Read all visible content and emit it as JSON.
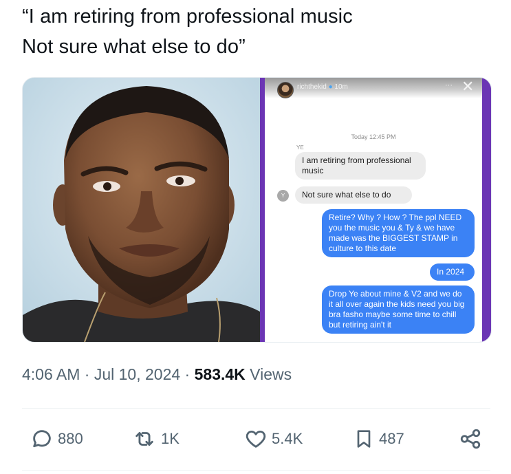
{
  "tweet": {
    "line1": "“I am retiring from professional music",
    "line2": "Not sure what else to do”"
  },
  "story": {
    "username": "richthekid",
    "age": "10m",
    "menu": "···",
    "close": "✕",
    "time": "Today 12:45 PM",
    "sender": "YE",
    "avatar_initial": "Y",
    "messages": [
      {
        "from": "ye",
        "text": "I am retiring from professional music"
      },
      {
        "from": "ye",
        "text": "Not sure what else to do"
      },
      {
        "from": "me",
        "text": "Retire? Why ? How ? The ppl NEED you the music you & Ty & we have made was the BIGGEST STAMP in culture to this date"
      },
      {
        "from": "me",
        "text": "In 2024"
      },
      {
        "from": "me",
        "text": "Drop Ye about mine & V2 and we do it all over again the kids need you big bra fasho maybe some time to chill but retiring ain't it"
      }
    ]
  },
  "meta": {
    "time": "4:06 AM",
    "sep1": " · ",
    "date": "Jul 10, 2024",
    "sep2": " · ",
    "views": "583.4K",
    "views_label": " Views"
  },
  "actions": {
    "replies": "880",
    "reposts": "1K",
    "likes": "5.4K",
    "bookmarks": "487"
  },
  "colors": {
    "text": "#0f1419",
    "secondary": "#536471",
    "story_border": "#6b35b4",
    "sent_bubble": "#3b82f5"
  },
  "icons": [
    "reply-icon",
    "repost-icon",
    "like-icon",
    "bookmark-icon",
    "share-icon"
  ]
}
